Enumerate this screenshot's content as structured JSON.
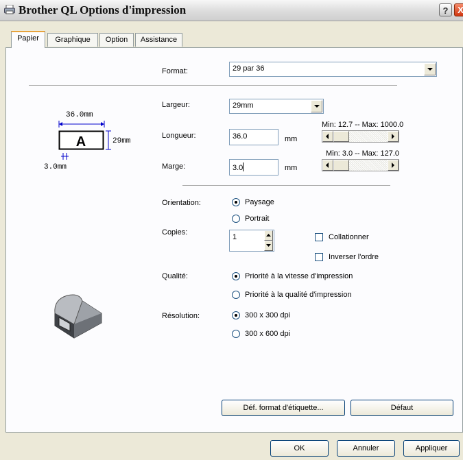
{
  "window": {
    "title": "Brother QL Options d'impression",
    "help_label": "?",
    "close_label": "X"
  },
  "tabs": [
    {
      "label": "Papier",
      "active": true
    },
    {
      "label": "Graphique",
      "active": false
    },
    {
      "label": "Option",
      "active": false
    },
    {
      "label": "Assistance",
      "active": false
    }
  ],
  "preview": {
    "width_label": "36.0mm",
    "height_label": "29mm",
    "margin_label": "3.0mm",
    "glyph": "A"
  },
  "format": {
    "label": "Format:",
    "value": "29 par 36"
  },
  "largeur": {
    "label": "Largeur:",
    "value": "29mm"
  },
  "longueur": {
    "label": "Longueur:",
    "value": "36.0",
    "unit": "mm",
    "range": "Min: 12.7 -- Max: 1000.0"
  },
  "marge": {
    "label": "Marge:",
    "value": "3.0",
    "unit": "mm",
    "range": "Min: 3.0 -- Max: 127.0"
  },
  "orientation": {
    "label": "Orientation:",
    "options": [
      {
        "label": "Paysage",
        "selected": true
      },
      {
        "label": "Portrait",
        "selected": false
      }
    ]
  },
  "copies": {
    "label": "Copies:",
    "value": "1",
    "collate_label": "Collationner",
    "collate_checked": false,
    "reverse_label": "Inverser l'ordre",
    "reverse_checked": false
  },
  "qualite": {
    "label": "Qualité:",
    "options": [
      {
        "label": "Priorité à la vitesse d'impression",
        "selected": true
      },
      {
        "label": "Priorité à la qualité d'impression",
        "selected": false
      }
    ]
  },
  "resolution": {
    "label": "Résolution:",
    "options": [
      {
        "label": "300 x 300 dpi",
        "selected": true
      },
      {
        "label": "300 x 600 dpi",
        "selected": false
      }
    ]
  },
  "buttons": {
    "def_format": "Déf. format d'étiquette...",
    "defaut": "Défaut",
    "ok": "OK",
    "annuler": "Annuler",
    "appliquer": "Appliquer"
  },
  "colors": {
    "accent_tab": "#e8a33c",
    "dimension_lines": "#0000cc",
    "close_button": "#d0360f"
  }
}
